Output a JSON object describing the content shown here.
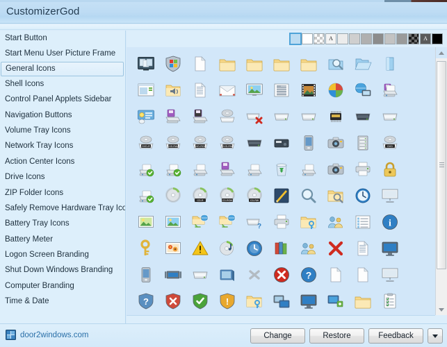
{
  "window": {
    "title": "CustomizerGod"
  },
  "sidebar": {
    "items": [
      {
        "label": "Start Button",
        "selected": false
      },
      {
        "label": "Start Menu User Picture Frame",
        "selected": false
      },
      {
        "label": "General Icons",
        "selected": true
      },
      {
        "label": "Shell Icons",
        "selected": false
      },
      {
        "label": "Control Panel Applets Sidebar",
        "selected": false
      },
      {
        "label": "Navigation Buttons",
        "selected": false
      },
      {
        "label": "Volume Tray Icons",
        "selected": false
      },
      {
        "label": "Network Tray Icons",
        "selected": false
      },
      {
        "label": "Action Center Icons",
        "selected": false
      },
      {
        "label": "Drive Icons",
        "selected": false
      },
      {
        "label": "ZIP Folder Icons",
        "selected": false
      },
      {
        "label": "Safely Remove Hardware Tray Icon",
        "selected": false
      },
      {
        "label": "Battery Tray Icons",
        "selected": false
      },
      {
        "label": "Battery Meter",
        "selected": false
      },
      {
        "label": "Logon Screen Branding",
        "selected": false
      },
      {
        "label": "Shut Down Windows Branding",
        "selected": false
      },
      {
        "label": "Computer Branding",
        "selected": false
      },
      {
        "label": "Time & Date",
        "selected": false
      }
    ]
  },
  "background_swatches": {
    "items": [
      {
        "name": "swatch-selected-lightblue",
        "kind": "solid",
        "color": "#bcdcf2",
        "selected": true
      },
      {
        "name": "swatch-white",
        "kind": "solid",
        "color": "#ffffff",
        "selected": false
      },
      {
        "name": "swatch-checker-light",
        "kind": "checker-light",
        "color": "#ffffff",
        "selected": false
      },
      {
        "name": "swatch-text-on-white",
        "kind": "letter-dark",
        "color": "#f4f4f4",
        "letter": "A",
        "selected": false
      },
      {
        "name": "swatch-gray-95",
        "kind": "solid",
        "color": "#ececec",
        "selected": false
      },
      {
        "name": "swatch-gray-80",
        "kind": "solid",
        "color": "#cfcfcf",
        "selected": false
      },
      {
        "name": "swatch-gray-65",
        "kind": "solid",
        "color": "#b0b0b0",
        "selected": false
      },
      {
        "name": "swatch-gray-50",
        "kind": "solid",
        "color": "#8c8c8c",
        "selected": false
      },
      {
        "name": "swatch-gray-40",
        "kind": "solid",
        "color": "#c3c3c3",
        "selected": false
      },
      {
        "name": "swatch-gray-30",
        "kind": "solid",
        "color": "#9a9a9a",
        "selected": false
      },
      {
        "name": "swatch-checker-dark",
        "kind": "checker-dark",
        "color": "#6e6e6e",
        "selected": false
      },
      {
        "name": "swatch-text-on-dark",
        "kind": "letter-light",
        "color": "#5a5a5a",
        "letter": "A",
        "selected": false
      },
      {
        "name": "swatch-black",
        "kind": "solid",
        "color": "#000000",
        "selected": false
      }
    ]
  },
  "icon_grid": {
    "background_color": "#d2e7f9",
    "columns": 10,
    "icons": [
      "slideshow-display-icon",
      "security-shield-icon",
      "blank-document-icon",
      "folder-icon",
      "folder-icon",
      "folder-icon",
      "folder-icon",
      "folder-search-icon",
      "folder-open-blue-icon",
      "folder-blue-icon",
      "window-preview-icon",
      "speaker-folder-icon",
      "text-document-icon",
      "open-envelope-icon",
      "picture-display-icon",
      "contact-card-icon",
      "film-strip-icon",
      "media-center-icon",
      "network-computer-icon",
      "network-printer-icon",
      "control-panel-icon",
      "floppy-drive-icon",
      "zip-drive-icon",
      "cd-drive-icon",
      "drive-error-icon",
      "hard-drive-icon",
      "drive-network-icon",
      "memory-chip-icon",
      "dark-drive-icon",
      "windows-drive-icon",
      "dvd-r-drive-icon",
      "dvd-ram-drive-icon",
      "dvd-rom-drive-icon",
      "dvd-rw-drive-icon",
      "external-drive-icon",
      "tape-drive-icon",
      "portable-player-icon",
      "camera-icon",
      "server-rack-icon",
      "dvd-drive-icon",
      "drive-check-icon",
      "drive-check-green-icon",
      "drive-plain-icon",
      "floppy-purple-icon",
      "drive-green-icon",
      "recycle-bin-icon",
      "scanner-icon",
      "camera-device-icon",
      "printer-icon",
      "padlock-icon",
      "drive-shield-icon",
      "cd-disc-icon",
      "cd-r-drive-icon",
      "cd-rom-drive-icon",
      "cd-rw-drive-icon",
      "paint-canvas-icon",
      "search-magnifier-icon",
      "search-folder-icon",
      "clock-icon",
      "presentation-icon",
      "picture-thumbnail-icon",
      "photo-frame-icon",
      "network-folder-icon",
      "network-folder-icon",
      "drive-help-icon",
      "printer-top-icon",
      "folder-shield-icon",
      "shield-users-icon",
      "list-view-icon",
      "info-bubble-icon",
      "key-icon",
      "photo-gallery-icon",
      "warning-triangle-icon",
      "audio-cd-icon",
      "history-clock-icon",
      "library-books-icon",
      "users-group-icon",
      "red-x-icon",
      "document-lines-icon",
      "monitor-icon",
      "mobile-device-icon",
      "display-settings-icon",
      "scanner-flat-icon",
      "window-stack-icon",
      "gray-x-icon",
      "error-circle-icon",
      "help-circle-icon",
      "document-page-icon",
      "document-page-icon",
      "projector-icon",
      "help-shield-icon",
      "error-shield-icon",
      "success-shield-icon",
      "warning-shield-icon",
      "folder-key-icon",
      "remote-desktop-icon",
      "display-blue-icon",
      "network-share-icon",
      "folder-plain-icon",
      "checklist-icon"
    ]
  },
  "scrollbars": {
    "vertical": {
      "up_arrow": "scroll-up-arrow-icon",
      "down_arrow": "scroll-down-arrow-icon"
    }
  },
  "footer": {
    "brand_icon": "door2windows-logo-icon",
    "brand_label": "door2windows.com",
    "buttons": [
      {
        "label": "Change",
        "name": "change-button"
      },
      {
        "label": "Restore",
        "name": "restore-button"
      },
      {
        "label": "Feedback",
        "name": "feedback-button"
      }
    ],
    "dropdown_icon": "caret-down-icon"
  }
}
